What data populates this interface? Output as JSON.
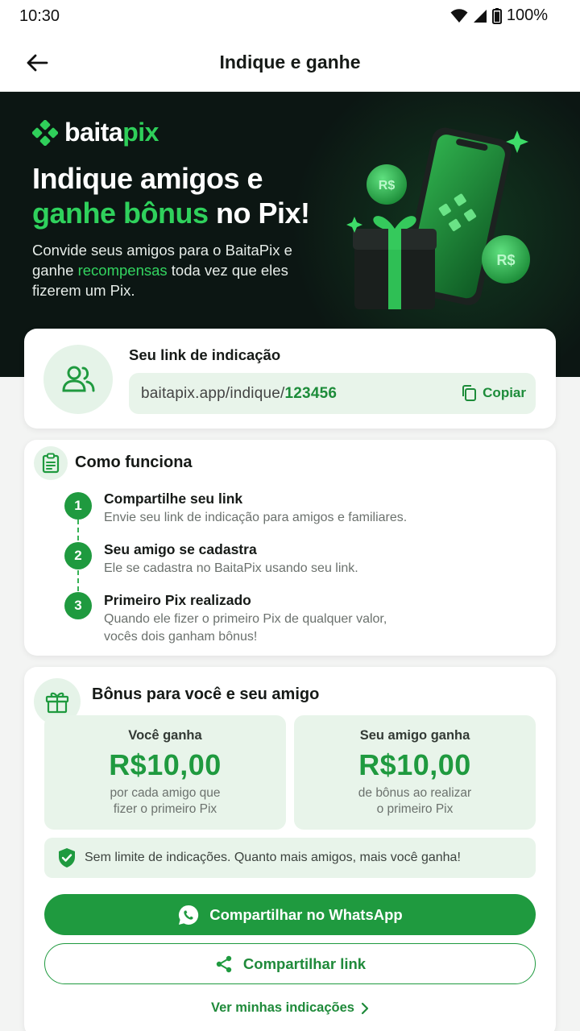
{
  "status_bar": {
    "time": "10:30",
    "battery": "100%"
  },
  "header": {
    "title": "Indique e ganhe"
  },
  "hero": {
    "brand_prefix": "baita",
    "brand_suffix": "pix",
    "title_line1": "Indique amigos e",
    "title_highlight": "ganhe bônus",
    "title_rest": " no Pix!",
    "desc_part1": "Convide seus amigos para o BaitaPix e ganhe ",
    "desc_highlight": "recompensas",
    "desc_part2": " toda vez que eles fizerem um Pix."
  },
  "referral": {
    "label": "Seu link de indicação",
    "url_base": "baitapix.app/indique/",
    "code": "123456",
    "copy_label": "Copiar"
  },
  "how_it_works": {
    "title": "Como funciona",
    "steps": [
      {
        "number": "1",
        "title": "Compartilhe seu link",
        "desc": "Envie seu link de indicação para amigos e familiares."
      },
      {
        "number": "2",
        "title": "Seu amigo se cadastra",
        "desc": "Ele se cadastra no BaitaPix usando seu link."
      },
      {
        "number": "3",
        "title": "Primeiro Pix realizado",
        "desc_line1": "Quando ele fizer o primeiro Pix de qualquer valor,",
        "desc_line2": "vocês dois ganham bônus!"
      }
    ]
  },
  "bonus": {
    "title": "Bônus para você e seu amigo",
    "you": {
      "label": "Você ganha",
      "value": "R$10,00",
      "desc_line1": "por cada amigo que",
      "desc_line2": "fizer o primeiro Pix"
    },
    "friend": {
      "label": "Seu amigo ganha",
      "value": "R$10,00",
      "desc_line1": "de bônus ao realizar",
      "desc_line2": "o primeiro Pix"
    },
    "limit_text": "Sem limite de indicações. Quanto mais amigos, mais você ganha!"
  },
  "actions": {
    "whatsapp_label": "Compartilhar no WhatsApp",
    "share_label": "Compartilhar link",
    "see_referrals_label": "Ver minhas indicações"
  },
  "icons": {
    "back": "arrow-left-icon",
    "users": "users-icon",
    "copy": "copy-icon",
    "clipboard": "clipboard-icon",
    "gift": "gift-icon",
    "shield": "shield-check-icon",
    "whatsapp": "whatsapp-icon",
    "share": "share-icon",
    "chevron": "chevron-right-icon"
  },
  "colors": {
    "accent": "#1f9a3f",
    "hero_bg": "#0c1613",
    "highlight": "#2fd15c",
    "soft_green": "#e8f4ea"
  }
}
